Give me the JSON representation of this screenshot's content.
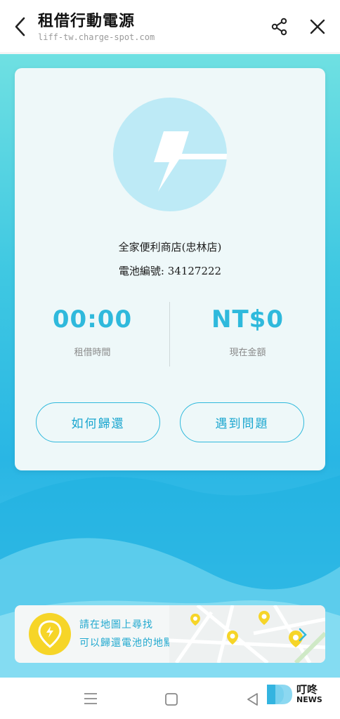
{
  "header": {
    "title": "租借行動電源",
    "url": "liff-tw.charge-spot.com",
    "back_icon": "back-arrow-icon",
    "share_icon": "share-icon",
    "close_icon": "close-icon"
  },
  "rental": {
    "store_name": "全家便利商店(忠林店)",
    "battery_id": "電池編號: 34127222",
    "elapsed_time": "00:00",
    "elapsed_label": "租借時間",
    "current_amount": "NT$0",
    "amount_label": "現在金額",
    "return_button": "如何歸還",
    "problem_button": "遇到問題"
  },
  "map_banner": {
    "line1": "請在地圖上尋找",
    "line2": "可以歸還電池的地點",
    "icon": "location-pin-icon"
  },
  "navbar": {
    "menu_icon": "recent-apps-icon",
    "home_icon": "home-icon",
    "back_icon": "nav-back-icon"
  },
  "watermark": {
    "line1": "叮咚",
    "line2": "NEWS"
  },
  "colors": {
    "accent": "#2fb9dc",
    "card_bg": "#eef8f9",
    "pin_yellow": "#f6d528"
  }
}
